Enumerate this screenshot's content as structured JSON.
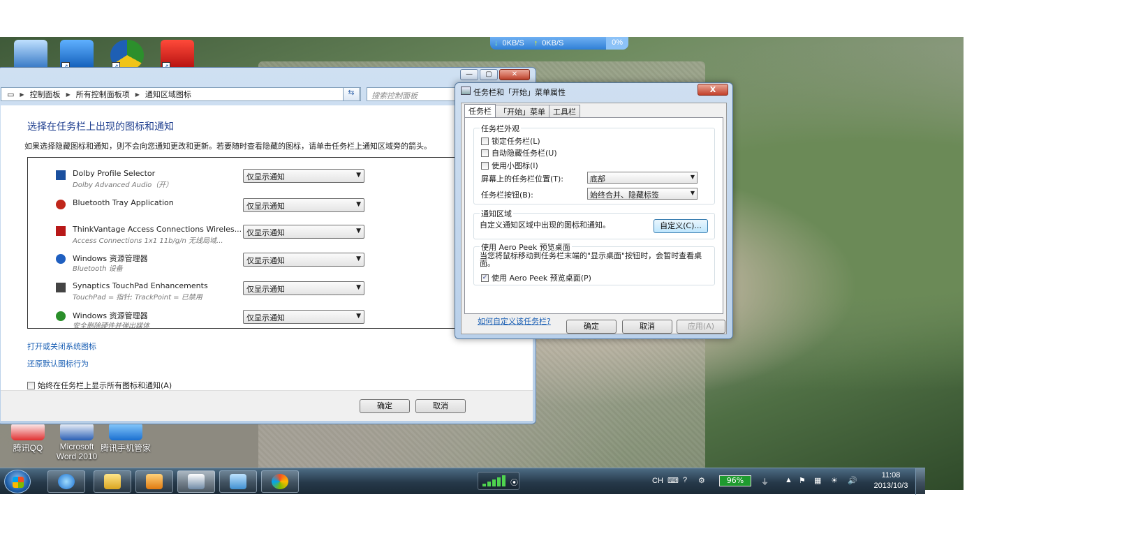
{
  "netmeter": {
    "down": "0KB/S",
    "up": "0KB/S",
    "usage": "0%"
  },
  "desktop_icons": [
    {
      "label": ""
    },
    {
      "label": ""
    },
    {
      "label": ""
    },
    {
      "label": ""
    },
    {
      "label": "腾讯QQ"
    },
    {
      "label": "Microsoft Word 2010"
    },
    {
      "label": "腾讯手机管家"
    }
  ],
  "explorer": {
    "breadcrumb": [
      "控制面板",
      "所有控制面板项",
      "通知区域图标"
    ],
    "search_placeholder": "搜索控制面板",
    "heading": "选择在任务栏上出现的图标和通知",
    "description": "如果选择隐藏图标和通知，则不会向您通知更改和更新。若要随时查看隐藏的图标，请单击任务栏上通知区域旁的箭头。",
    "rows": [
      {
        "name": "Dolby Profile Selector",
        "sub": "Dolby Advanced Audio（开）",
        "behavior": "仅显示通知",
        "icon_color": "#1a4f9e"
      },
      {
        "name": "Bluetooth Tray Application",
        "sub": "",
        "behavior": "仅显示通知",
        "icon_color": "#c0271b"
      },
      {
        "name": "ThinkVantage Access Connections Wireles...",
        "sub": "Access Connections  1x1 11b/g/n 无线局域...",
        "behavior": "仅显示通知",
        "icon_color": "#b81818"
      },
      {
        "name": "Windows 资源管理器",
        "sub": "Bluetooth 设备",
        "behavior": "仅显示通知",
        "icon_color": "#1f5fc0"
      },
      {
        "name": "Synaptics TouchPad Enhancements",
        "sub": "TouchPad = 指针; TrackPoint = 已禁用",
        "behavior": "仅显示通知",
        "icon_color": "#444444"
      },
      {
        "name": "Windows 资源管理器",
        "sub": "安全删除硬件并弹出媒体",
        "behavior": "仅显示通知",
        "icon_color": "#2a8f2a"
      }
    ],
    "link_system_icons": "打开或关闭系统图标",
    "link_restore": "还原默认图标行为",
    "always_show_label": "始终在任务栏上显示所有图标和通知(A)",
    "ok": "确定",
    "cancel": "取消"
  },
  "props": {
    "title": "任务栏和「开始」菜单属性",
    "close": "X",
    "tabs": [
      "任务栏",
      "「开始」菜单",
      "工具栏"
    ],
    "group_appearance": "任务栏外观",
    "lock_taskbar": "锁定任务栏(L)",
    "autohide": "自动隐藏任务栏(U)",
    "small_icons": "使用小图标(I)",
    "location_label": "屏幕上的任务栏位置(T):",
    "location_value": "底部",
    "buttons_label": "任务栏按钮(B):",
    "buttons_value": "始终合并、隐藏标签",
    "group_notify": "通知区域",
    "notify_desc": "自定义通知区域中出现的图标和通知。",
    "customize": "自定义(C)...",
    "group_peek": "使用 Aero Peek 预览桌面",
    "peek_desc": "当您将鼠标移动到任务栏末端的\"显示桌面\"按钮时，会暂时查看桌面。",
    "peek_check": "使用 Aero Peek 预览桌面(P)",
    "peek_checked": "✓",
    "help": "如何自定义该任务栏?",
    "ok": "确定",
    "cancel": "取消",
    "apply": "应用(A)"
  },
  "taskbar": {
    "lang": "CH",
    "battery": "96%",
    "time": "11:08",
    "date": "2013/10/3"
  },
  "colors": {
    "accent": "#1f3f8f",
    "link": "#1a5fb4",
    "battery": "#1f9a2f"
  }
}
